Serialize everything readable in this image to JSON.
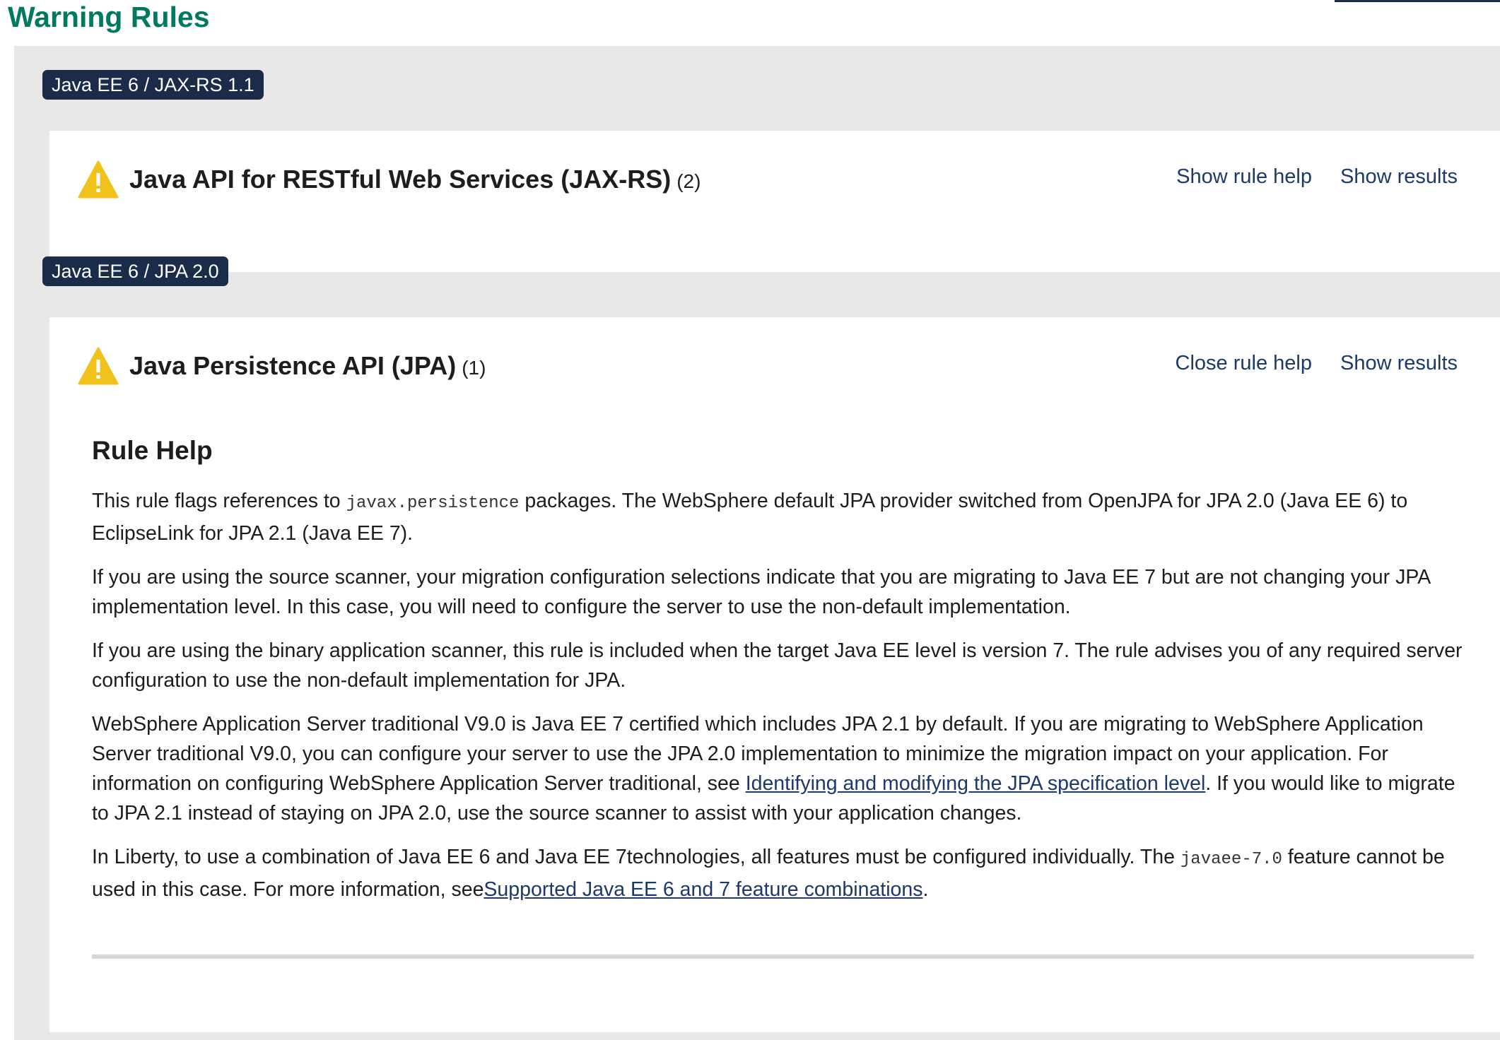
{
  "page": {
    "title": "Warning Rules"
  },
  "categories": [
    {
      "tag": "Java EE 6 / JAX-RS 1.1",
      "rule": {
        "title": "Java API for RESTful Web Services (JAX-RS)",
        "count": "(2)",
        "help_action": "Show rule help",
        "results_action": "Show results"
      }
    },
    {
      "tag": "Java EE 6 / JPA 2.0",
      "rule": {
        "title": "Java Persistence API (JPA)",
        "count": "(1)",
        "help_action": "Close rule help",
        "results_action": "Show results",
        "help": {
          "heading": "Rule Help",
          "p1": {
            "before": "This rule flags references to ",
            "code": "javax.persistence",
            "after": " packages. The WebSphere default JPA provider switched from OpenJPA for JPA 2.0 (Java EE 6) to EclipseLink for JPA 2.1 (Java EE 7)."
          },
          "p2": "If you are using the source scanner, your migration configuration selections indicate that you are migrating to Java EE 7 but are not changing your JPA implementation level. In this case, you will need to configure the server to use the non-default implementation.",
          "p3": "If you are using the binary application scanner, this rule is included when the target Java EE level is version 7. The rule advises you of any required server configuration to use the non-default implementation for JPA.",
          "p4": {
            "before": "WebSphere Application Server traditional V9.0 is Java EE 7 certified which includes JPA 2.1 by default. If you are migrating to WebSphere Application Server traditional V9.0, you can configure your server to use the JPA 2.0 implementation to minimize the migration impact on your application. For information on configuring WebSphere Application Server traditional, see ",
            "link": "Identifying and modifying the JPA specification level",
            "after": ". If you would like to migrate to JPA 2.1 instead of staying on JPA 2.0, use the source scanner to assist with your application changes."
          },
          "p5": {
            "before": "In Liberty, to use a combination of Java EE 6 and Java EE 7technologies, all features must be configured individually. The ",
            "code": "javaee-7.0",
            "middle": " feature cannot be used in this case. For more information, see",
            "link": "Supported Java EE 6 and 7 feature combinations",
            "after": "."
          }
        }
      }
    }
  ],
  "icons": {
    "warning": "warning-triangle-icon"
  },
  "colors": {
    "title_green": "#007a5e",
    "tag_navy": "#1b2c4a",
    "link_blue": "#1b3a6b",
    "warning_yellow": "#f1c21b",
    "panel_gray": "#e8e8e8"
  }
}
